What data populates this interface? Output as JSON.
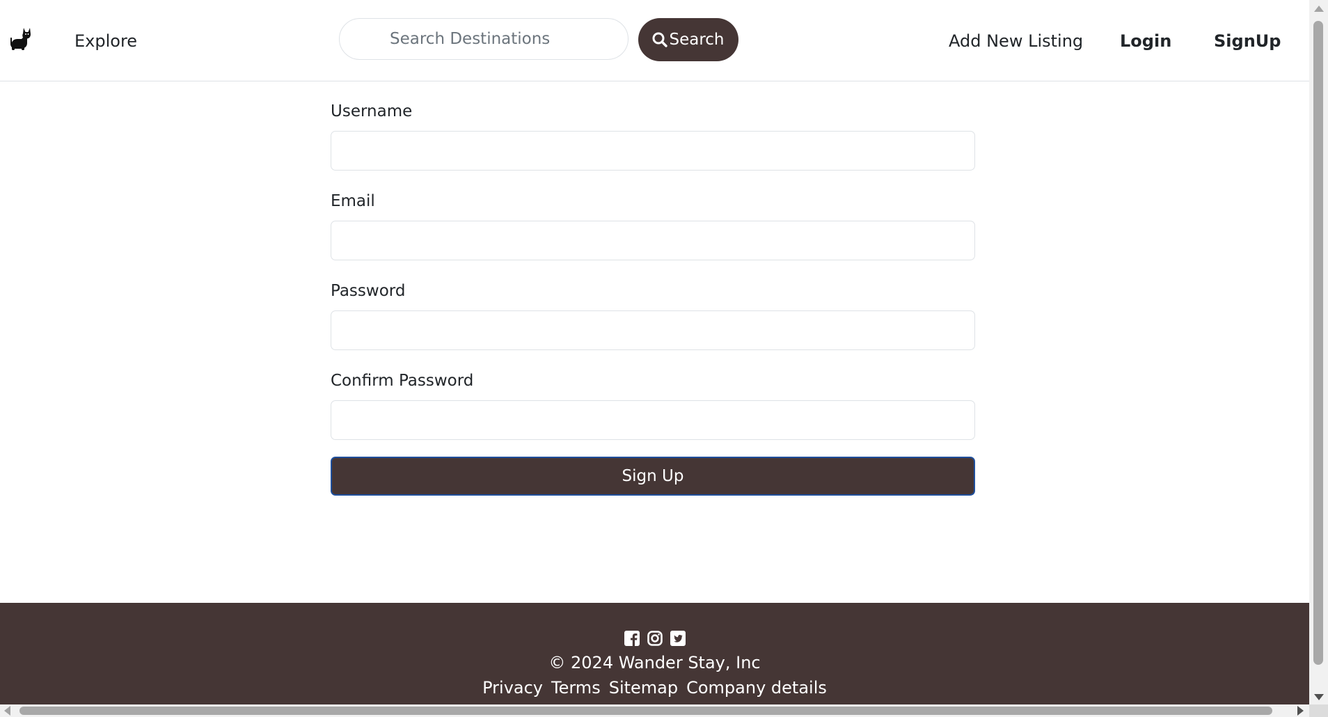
{
  "navbar": {
    "brand_icon": "cat-icon",
    "explore_label": "Explore",
    "search_placeholder": "Search Destinations",
    "search_value": "",
    "search_button_label": "Search",
    "search_icon": "magnifier-icon",
    "add_listing_label": "Add New Listing",
    "login_label": "Login",
    "signup_label": "SignUp"
  },
  "form": {
    "username_label": "Username",
    "username_value": "",
    "email_label": "Email",
    "email_value": "",
    "password_label": "Password",
    "password_value": "",
    "confirm_password_label": "Confirm Password",
    "confirm_password_value": "",
    "submit_label": "Sign Up"
  },
  "footer": {
    "social_icons": [
      "facebook-icon",
      "instagram-icon",
      "twitter-icon"
    ],
    "copyright": "© 2024 Wander Stay, Inc",
    "links": [
      "Privacy",
      "Terms",
      "Sitemap",
      "Company details"
    ]
  },
  "colors": {
    "brand_dark": "#453635",
    "border": "#dee2e6",
    "focus_border": "#1f4f9c",
    "text": "#212529",
    "placeholder": "#6c757d"
  }
}
